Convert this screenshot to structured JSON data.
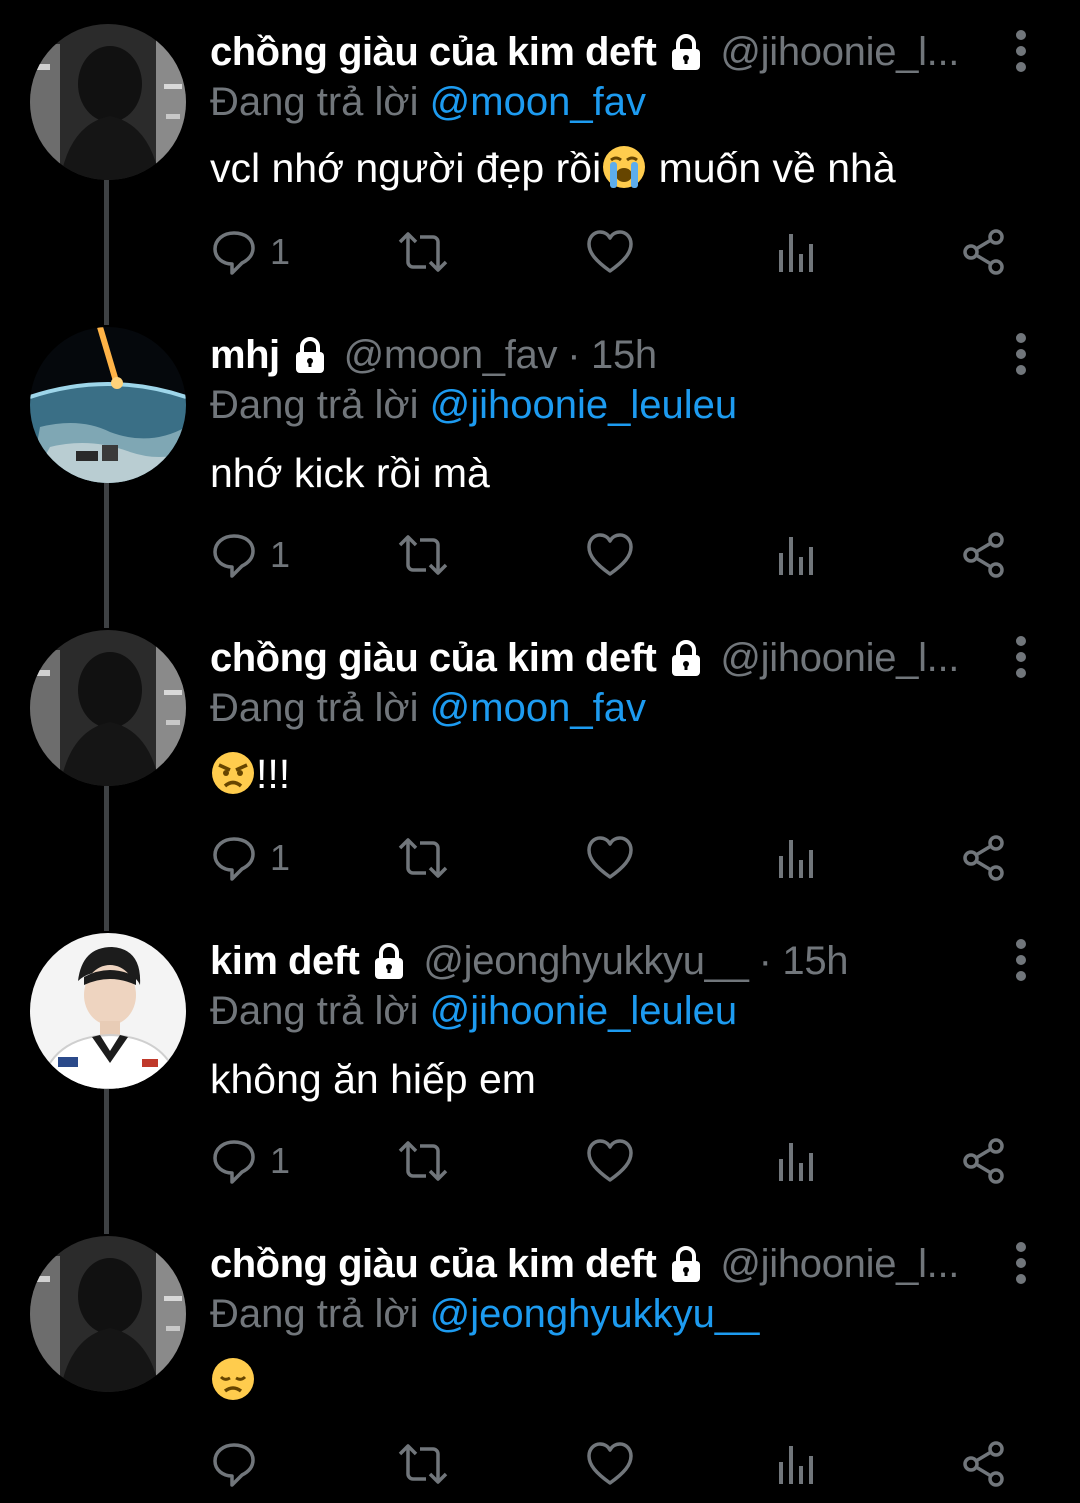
{
  "reply_prefix": "Đang trả lời",
  "icons": {
    "reply": "reply-icon",
    "retweet": "retweet-icon",
    "like": "like-icon",
    "views": "views-icon",
    "share": "share-icon",
    "lock": "lock-icon",
    "more": "more-icon"
  },
  "colors": {
    "background": "#000000",
    "name": "#ffffff",
    "muted": "#71767b",
    "mention": "#1d9bf0",
    "thread_line": "#3e4144"
  },
  "tweets": [
    {
      "name": "chồng giàu của kim deft",
      "handle": "@jihoonie_l...",
      "time": "",
      "reply_to": "@moon_fav",
      "text": "vcl nhớ người đẹp rồi",
      "emoji": "loudly-crying-face",
      "text_after": " muốn về nhà",
      "reply_count": "1"
    },
    {
      "name": "mhj",
      "handle": "@moon_fav",
      "time": "· 15h",
      "reply_to": "@jihoonie_leuleu",
      "text": "nhớ kick rồi mà",
      "emoji": "",
      "text_after": "",
      "reply_count": "1"
    },
    {
      "name": "chồng giàu của kim deft",
      "handle": "@jihoonie_l...",
      "time": "",
      "reply_to": "@moon_fav",
      "text": "",
      "emoji": "angry-face",
      "text_after": "!!!",
      "reply_count": "1"
    },
    {
      "name": "kim deft",
      "handle": "@jeonghyukkyu__",
      "time": "· 15h",
      "reply_to": "@jihoonie_leuleu",
      "text": "không ăn hiếp em",
      "emoji": "",
      "text_after": "",
      "reply_count": "1"
    },
    {
      "name": "chồng giàu của kim deft",
      "handle": "@jihoonie_l...",
      "time": "",
      "reply_to": "@jeonghyukkyu__",
      "text": "",
      "emoji": "disappointed-face",
      "text_after": "",
      "reply_count": ""
    }
  ]
}
